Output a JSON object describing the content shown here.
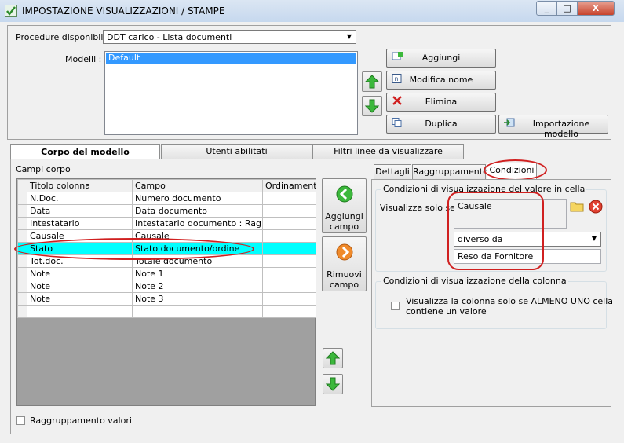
{
  "window": {
    "title": "IMPOSTAZIONE VISUALIZZAZIONI / STAMPE",
    "min": "_",
    "max": "□",
    "close": "X"
  },
  "top": {
    "procedure_label": "Procedure disponibili :",
    "procedure_value": "DDT carico - Lista documenti",
    "modelli_label": "Modelli :",
    "modelli_items": [
      "Default"
    ],
    "buttons": {
      "aggiungi": "Aggiungi",
      "modifica": "Modifica nome",
      "elimina": "Elimina",
      "duplica": "Duplica",
      "importazione": "Importazione modello"
    }
  },
  "tabs": [
    "Corpo del modello",
    "Utenti abilitati",
    "Filtri linee da visualizzare"
  ],
  "campi": {
    "label": "Campi corpo",
    "headers": [
      "Titolo colonna",
      "Campo",
      "Ordinamento"
    ],
    "rows": [
      [
        "N.Doc.",
        "Numero documento",
        ""
      ],
      [
        "Data",
        "Data documento",
        ""
      ],
      [
        "Intestatario",
        "Intestatario documento : Ragion...",
        ""
      ],
      [
        "Causale",
        "Causale",
        ""
      ],
      [
        "Stato",
        "Stato documento/ordine",
        ""
      ],
      [
        "Tot.doc.",
        "Totale documento",
        ""
      ],
      [
        "Note",
        "Note 1",
        ""
      ],
      [
        "Note",
        "Note 2",
        ""
      ],
      [
        "Note",
        "Note 3",
        ""
      ],
      [
        "",
        "",
        ""
      ]
    ],
    "highlight_row": 4,
    "aggiungi_campo": [
      "Aggiungi",
      "campo"
    ],
    "rimuovi_campo": [
      "Rimuovi",
      "campo"
    ],
    "raggruppamento_valori": "Raggruppamento valori"
  },
  "subtabs": [
    "Dettagli",
    "Raggruppamento",
    "Condizioni"
  ],
  "condizioni": {
    "group1_title": "Condizioni di visualizzazione del valore in cella",
    "visualizza_label": "Visualizza solo se:",
    "field_value": "Causale",
    "operator_value": "diverso da",
    "compare_value": "Reso da Fornitore",
    "group2_title": "Condizioni di visualizzazione della colonna",
    "almeno_uno_line1": "Visualizza la colonna solo se ALMENO UNO cella",
    "almeno_uno_line2": "contiene un valore"
  },
  "colors": {
    "highlight": "#00ffff",
    "annotation": "#d02020",
    "selection": "#3399ff",
    "close": "#c7432c"
  }
}
